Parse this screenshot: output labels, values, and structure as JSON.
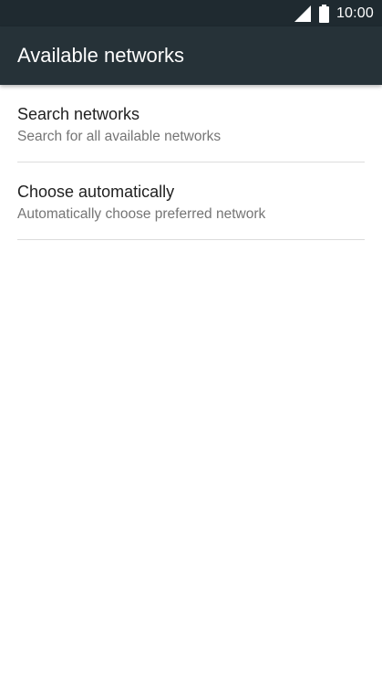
{
  "status_bar": {
    "time": "10:00",
    "icons": [
      "signal-icon",
      "battery-icon"
    ]
  },
  "app_bar": {
    "title": "Available networks",
    "background": "#263238"
  },
  "list": {
    "items": [
      {
        "title": "Search networks",
        "summary": "Search for all available networks"
      },
      {
        "title": "Choose automatically",
        "summary": "Automatically choose preferred network"
      }
    ]
  }
}
